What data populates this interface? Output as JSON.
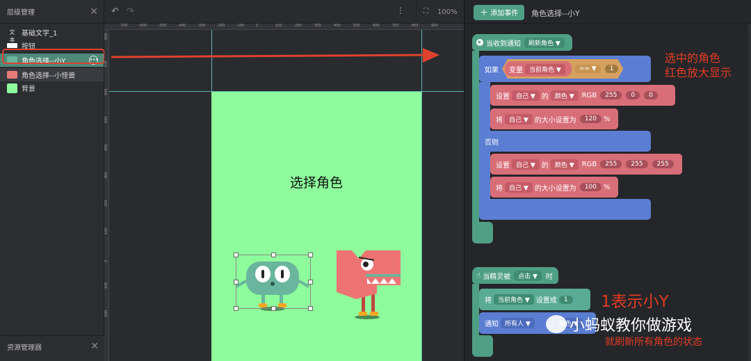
{
  "layers": {
    "title": "层级管理",
    "items": [
      {
        "label": "基础文字_1",
        "icon": "text-icon"
      },
      {
        "label": "按钮",
        "icon": "button-icon"
      },
      {
        "label": "角色选择--小Y",
        "icon": "sprite-icon"
      },
      {
        "label": "角色选择--小怪兽",
        "icon": "sprite-icon"
      },
      {
        "label": "背景",
        "icon": "background-icon"
      }
    ]
  },
  "assets": {
    "title": "资源管理器"
  },
  "stage": {
    "zoom": "100%",
    "canvas_title": "选择角色",
    "ruler_top": [
      "-700",
      "-600",
      "-500",
      "-400",
      "-300",
      "-200",
      "-100",
      "0",
      "100",
      "200",
      "300",
      "400",
      "500",
      "600",
      "700",
      "800",
      "900"
    ],
    "ruler_left": [
      "800",
      "700",
      "600",
      "500",
      "400",
      "300",
      "200",
      "100",
      "0",
      "-100",
      "-200"
    ],
    "canvas_color": "#8efb9c",
    "annotation_color": "#e33b23"
  },
  "editor": {
    "add_event": "添加事件",
    "title": "角色选择--小Y",
    "event1": {
      "head": "当收到通知",
      "notice": "刷新角色",
      "if": "如果",
      "var_label": "变量",
      "var_name": "当前角色",
      "op": "==",
      "value": "1",
      "set1": {
        "pre": "设置",
        "who": "自己",
        "of": "的",
        "prop": "颜色",
        "rgb": "RGB",
        "r": "255",
        "gg": "0",
        "bb": "0"
      },
      "size1": {
        "pre": "将",
        "who": "自己",
        "text": "的大小设置为",
        "val": "120",
        "unit": "%"
      },
      "else": "否则",
      "set2": {
        "pre": "设置",
        "who": "自己",
        "of": "的",
        "prop": "颜色",
        "rgb": "RGB",
        "r": "255",
        "gg": "255",
        "bb": "255"
      },
      "size2": {
        "pre": "将",
        "who": "自己",
        "text": "的大小设置为",
        "val": "100",
        "unit": "%"
      }
    },
    "event2": {
      "head": "当精灵被",
      "action": "点击",
      "when": "时",
      "set": {
        "pre": "将",
        "var": "当前角色",
        "text": "设置成",
        "val": "1"
      },
      "notify": {
        "pre": "通知",
        "who": "所有人",
        "var": "角色"
      }
    }
  },
  "annotations": {
    "a1_line1": "选中的角色",
    "a1_line2": "红色放大显示",
    "a2": "1表示小Y",
    "a3": "就刷新所有角色的状态",
    "watermark": "小蚂蚁教你做游戏"
  }
}
